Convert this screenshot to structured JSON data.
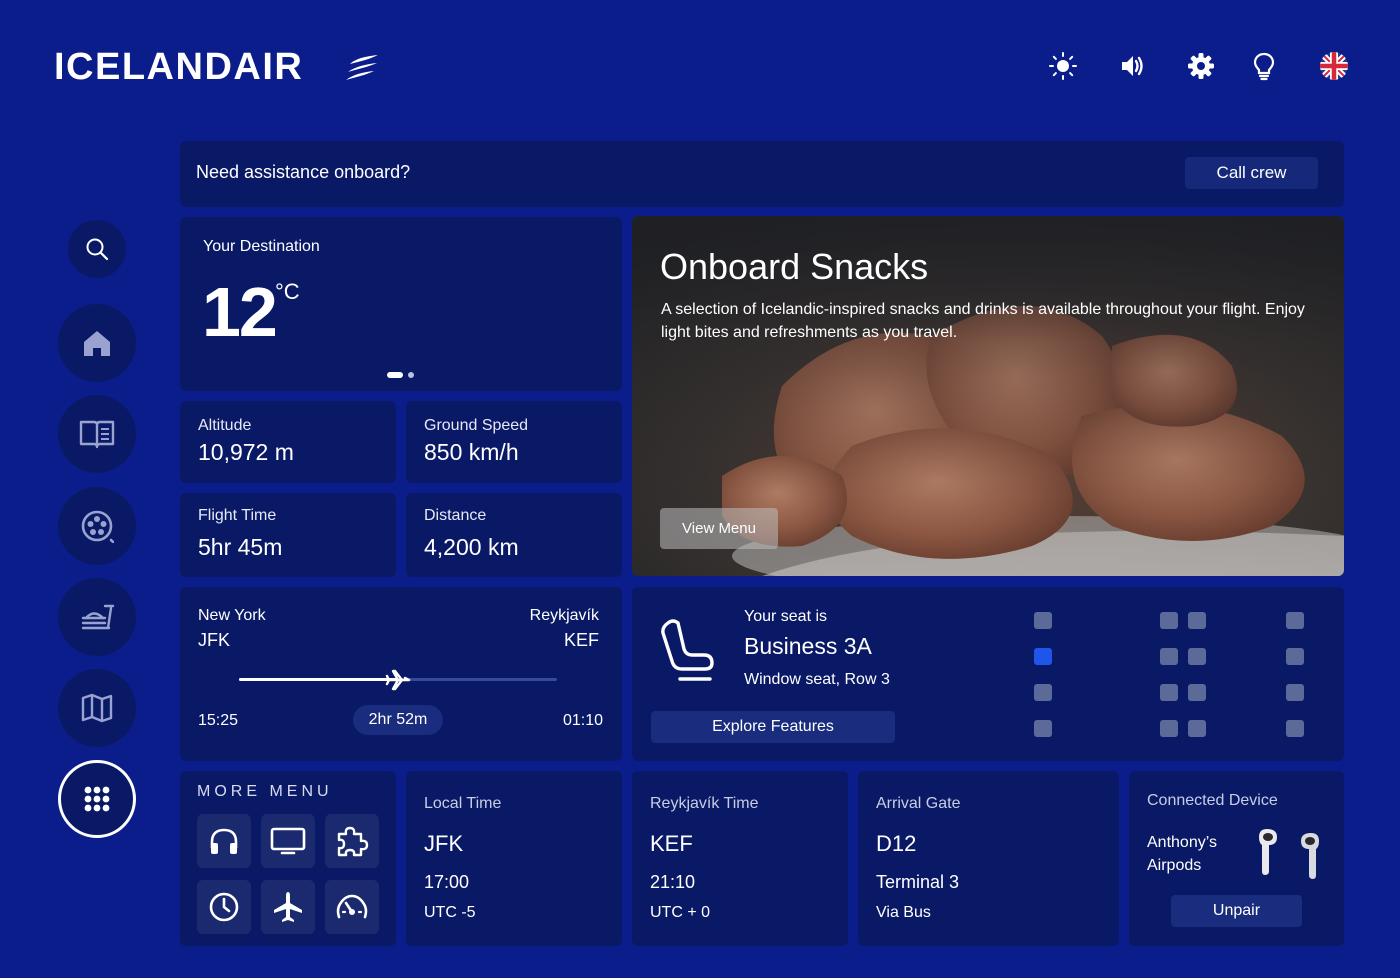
{
  "header": {
    "logo": "ICELANDAIR",
    "icons": [
      "brightness-icon",
      "volume-icon",
      "settings-icon",
      "lightbulb-icon",
      "uk-flag-icon"
    ]
  },
  "sidebar": {
    "items": [
      "search",
      "home",
      "guide",
      "entertainment",
      "dining",
      "map",
      "more-apps"
    ],
    "active": "more-apps"
  },
  "assist": {
    "text": "Need assistance onboard?",
    "button": "Call crew"
  },
  "destination": {
    "label": "Your Destination",
    "temp": "12",
    "unit": "°C",
    "page": 1,
    "pages": 2
  },
  "stats": {
    "altitude_label": "Altitude",
    "altitude": "10,972 m",
    "speed_label": "Ground Speed",
    "speed": "850 km/h",
    "flighttime_label": "Flight Time",
    "flighttime": "5hr 45m",
    "distance_label": "Distance",
    "distance": "4,200 km"
  },
  "snacks": {
    "title": "Onboard Snacks",
    "description": "A selection of Icelandic-inspired snacks and drinks is available throughout your flight. Enjoy light bites and refreshments as you travel.",
    "button": "View Menu"
  },
  "route": {
    "from_city": "New York",
    "from_code": "JFK",
    "to_city": "Reykjavík",
    "to_code": "KEF",
    "depart": "15:25",
    "arrive": "01:10",
    "remaining": "2hr 52m",
    "progress": 0.5
  },
  "seat": {
    "label": "Your seat is",
    "name": "Business 3A",
    "detail": "Window seat, Row 3",
    "button": "Explore Features"
  },
  "more_menu": {
    "title": "MORE MENU",
    "tiles": [
      "headphones-icon",
      "screen-icon",
      "puzzle-icon",
      "clock-icon",
      "airplane-icon",
      "speedometer-icon"
    ]
  },
  "local_time": {
    "label": "Local Time",
    "code": "JFK",
    "time": "17:00",
    "zone": "UTC -5"
  },
  "rvk_time": {
    "label": "Reykjavík Time",
    "code": "KEF",
    "time": "21:10",
    "zone": "UTC + 0"
  },
  "gate": {
    "label": "Arrival Gate",
    "gate": "D12",
    "terminal": "Terminal 3",
    "transfer": "Via Bus"
  },
  "device": {
    "label": "Connected Device",
    "name": "Anthony’s Airpods",
    "button": "Unpair"
  },
  "colors": {
    "background": "#0b1d8a",
    "card": "#0a1965",
    "button": "#1a2c7d",
    "selected_seat": "#1f55e8",
    "seat": "#5c6a9a"
  }
}
